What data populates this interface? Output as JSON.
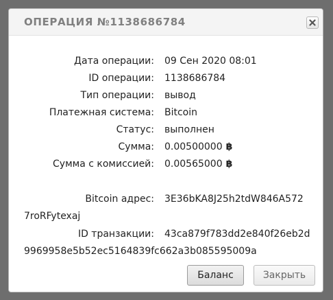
{
  "dialog": {
    "title": "ОПЕРАЦИЯ №1138686784"
  },
  "details": {
    "date_label": "Дата операции:",
    "date_value": "09 Сен 2020 08:01",
    "id_label": "ID операции:",
    "id_value": "1138686784",
    "type_label": "Тип операции:",
    "type_value": "вывод",
    "system_label": "Платежная система:",
    "system_value": "Bitcoin",
    "status_label": "Статус:",
    "status_value": "выполнен",
    "amount_label": "Сумма:",
    "amount_value": "0.00500000",
    "fee_amount_label": "Сумма с комиссией:",
    "fee_amount_value": "0.00565000",
    "currency_symbol": "฿",
    "address_label": "Bitcoin адрес:",
    "address_line1": "3E36bKA8J25h2tdW846A572",
    "address_line2": "7roRFytexaj",
    "tx_label": "ID транзакции:",
    "tx_line1": "43ca879f783dd2e840f26eb2d",
    "tx_line2": "9969958e5b52ec5164839fc662a3b085595009a"
  },
  "buttons": {
    "balance_label": "Баланс",
    "close_label": "Закрыть"
  }
}
